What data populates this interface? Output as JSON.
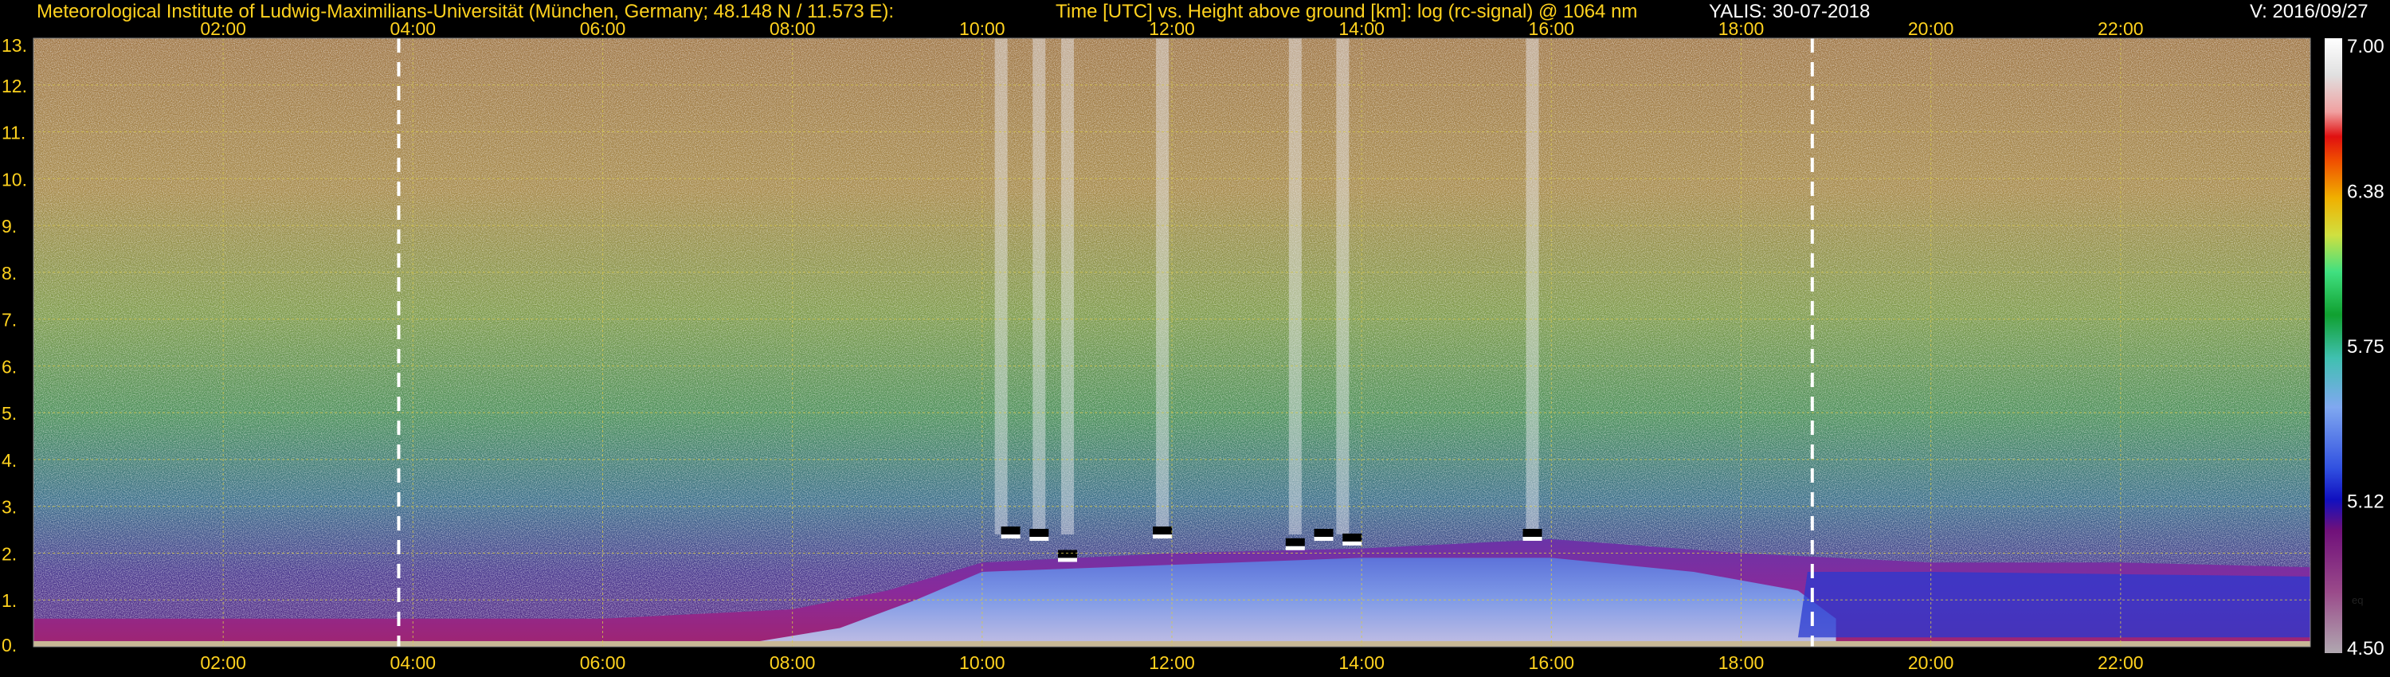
{
  "header": {
    "institute": "Meteorological Institute of Ludwig-Maximilians-Universität (München, Germany; 48.148 N / 11.573 E):",
    "description": "Time [UTC] vs. Height above ground [km]: log (rc-signal) @ 1064 nm",
    "station_date": "YALIS: 30-07-2018",
    "version": "V: 2016/09/27"
  },
  "colors": {
    "label": "#ffd21e",
    "grid": "#d6c84a",
    "background": "#000000",
    "marker_line": "#ffffff"
  },
  "chart_data": {
    "type": "heatmap",
    "title": "Time [UTC] vs. Height above ground [km]: log (rc-signal) @ 1064 nm",
    "x": {
      "label": "Time [UTC]",
      "range_hours": [
        0,
        24
      ],
      "ticks": [
        "02:00",
        "04:00",
        "06:00",
        "08:00",
        "10:00",
        "12:00",
        "14:00",
        "16:00",
        "18:00",
        "20:00",
        "22:00"
      ],
      "tick_hours": [
        2,
        4,
        6,
        8,
        10,
        12,
        14,
        16,
        18,
        20,
        22
      ],
      "marker_lines_hours": [
        3.85,
        18.75
      ]
    },
    "y": {
      "label": "Height above ground [km]",
      "range_km": [
        0,
        13
      ],
      "ticks": [
        "0.",
        "1.",
        "2.",
        "3.",
        "4.",
        "5.",
        "6.",
        "7.",
        "8.",
        "9.",
        "10.",
        "11.",
        "12.",
        "13."
      ],
      "tick_values": [
        0,
        1,
        2,
        3,
        4,
        5,
        6,
        7,
        8,
        9,
        10,
        11,
        12,
        13
      ]
    },
    "colorbar": {
      "range": [
        4.5,
        7.0
      ],
      "tick_labels": [
        "4.50",
        "5.12",
        "5.75",
        "6.38",
        "7.00"
      ],
      "tick_values": [
        4.5,
        5.12,
        5.75,
        6.38,
        7.0
      ],
      "small_label": "eq"
    },
    "grid": true,
    "features": {
      "boundary_layer_top_km": [
        [
          0,
          0.6
        ],
        [
          6,
          0.6
        ],
        [
          8,
          0.8
        ],
        [
          9,
          1.2
        ],
        [
          10,
          1.8
        ],
        [
          12,
          2.0
        ],
        [
          14,
          2.1
        ],
        [
          16,
          2.3
        ],
        [
          18,
          2.0
        ],
        [
          20,
          1.8
        ],
        [
          22,
          1.8
        ],
        [
          24,
          1.7
        ]
      ],
      "convective_plumes_hours": [
        10.2,
        10.6,
        10.9,
        11.9,
        13.3,
        13.8,
        15.8
      ],
      "cloud_base_km": [
        [
          10.3,
          2.5
        ],
        [
          10.6,
          2.45
        ],
        [
          10.9,
          2.0
        ],
        [
          11.9,
          2.5
        ],
        [
          13.3,
          2.25
        ],
        [
          13.6,
          2.45
        ],
        [
          13.9,
          2.35
        ],
        [
          15.8,
          2.45
        ]
      ]
    }
  }
}
